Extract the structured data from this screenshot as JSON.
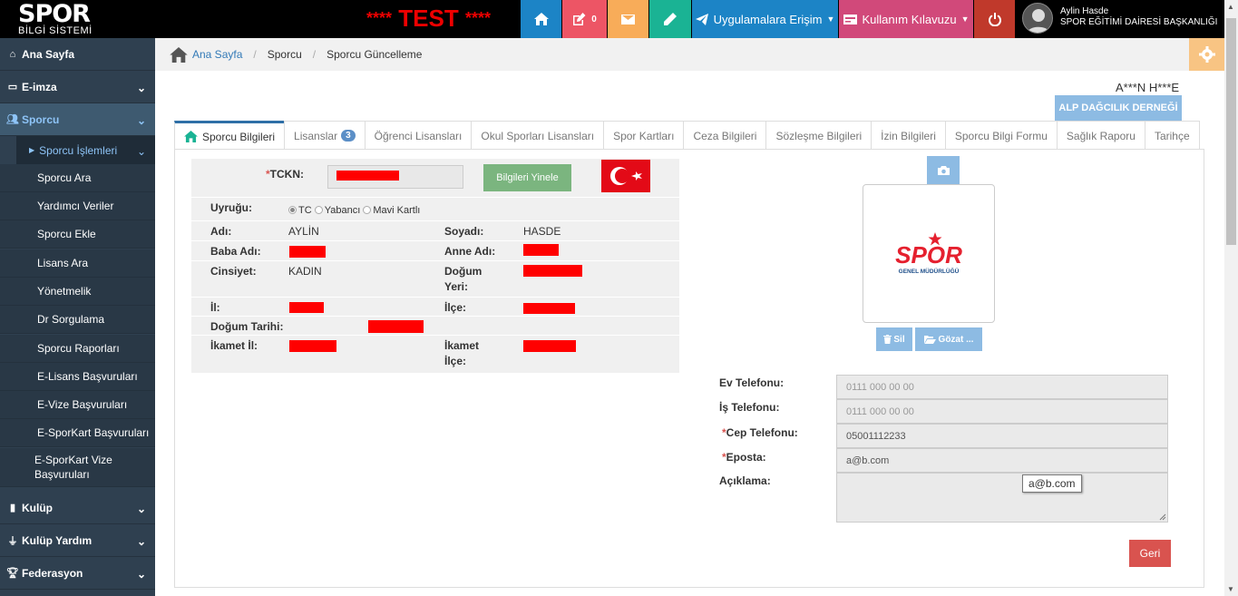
{
  "app": {
    "logo_line1": "SPOR",
    "logo_line2": "BİLGİ SİSTEMİ",
    "test_label": "TEST",
    "test_stars": "****"
  },
  "topbar": {
    "notifications_count": "0",
    "apps_access_label": "Uygulamalara Erişim",
    "user_guide_label": "Kullanım Kılavuzu",
    "user_name": "Aylin Hasde",
    "user_department": "SPOR EĞİTİMİ DAİRESİ BAŞKANLIĞI",
    "colors": {
      "home": "#1c84c6",
      "edit": "#ed5565",
      "mail": "#f8ac59",
      "pencil": "#1ab394",
      "apps": "#1c84c6",
      "guide": "#d1497a",
      "power": "#c0392b"
    }
  },
  "sidebar": {
    "items": [
      {
        "label": "Ana Sayfa",
        "icon": "home-icon"
      },
      {
        "label": "E-imza",
        "icon": "card-icon"
      },
      {
        "label": "Sporcu",
        "icon": "users-icon"
      },
      {
        "label": "Kulüp",
        "icon": "bar-chart-icon"
      },
      {
        "label": "Kulüp Yardım",
        "icon": "plug-icon"
      },
      {
        "label": "Federasyon",
        "icon": "trophy-icon"
      }
    ],
    "subheader": "Sporcu İşlemleri",
    "subitems": [
      "Sporcu Ara",
      "Yardımcı Veriler",
      "Sporcu Ekle",
      "Lisans Ara",
      "Yönetmelik",
      "Dr Sorgulama",
      "Sporcu Raporları",
      "E-Lisans Başvuruları",
      "E-Vize Başvuruları",
      "E-SporKart Başvuruları",
      "E-SporKart Vize Başvuruları"
    ]
  },
  "breadcrumb": [
    "Ana Sayfa",
    "Sporcu",
    "Sporcu Güncelleme"
  ],
  "athlete_masked_name": "A***N H***E",
  "club_button": "ALP DAĞCILIK DERNEĞİ",
  "tabs": [
    {
      "label": "Sporcu Bilgileri",
      "active": true
    },
    {
      "label": "Lisanslar",
      "badge": "3"
    },
    {
      "label": "Öğrenci Lisansları"
    },
    {
      "label": "Okul Sporları Lisansları"
    },
    {
      "label": "Spor Kartları"
    },
    {
      "label": "Ceza Bilgileri"
    },
    {
      "label": "Sözleşme Bilgileri"
    },
    {
      "label": "İzin Bilgileri"
    },
    {
      "label": "Sporcu Bilgi Formu"
    },
    {
      "label": "Sağlık Raporu"
    },
    {
      "label": "Tarihçe"
    }
  ],
  "form": {
    "required_mark": "*",
    "tckn_label": "TCKN:",
    "refresh_button": "Bilgileri Yinele",
    "nationality_label": "Uyruğu:",
    "nationality_options": [
      "TC",
      "Yabancı",
      "Mavi Kartlı"
    ],
    "nationality_selected": "TC",
    "ad_label": "Adı:",
    "ad_value": "AYLİN",
    "soyad_label": "Soyadı:",
    "soyad_value": "HASDE",
    "baba_label": "Baba Adı:",
    "anne_label": "Anne Adı:",
    "cinsiyet_label": "Cinsiyet:",
    "cinsiyet_value": "KADIN",
    "dogum_yeri_label_1": "Doğum",
    "dogum_yeri_label_2": "Yeri:",
    "il_label": "İl:",
    "ilce_label": "İlçe:",
    "dogum_tarihi_label": "Doğum Tarihi:",
    "ikamet_il_label": "İkamet İl:",
    "ikamet_ilce_label_1": "İkamet",
    "ikamet_ilce_label_2": "İlçe:"
  },
  "photo": {
    "logo_text": "SPOR",
    "logo_sub": "GENEL MÜDÜRLÜĞÜ",
    "delete_button": "Sil",
    "browse_button": "Gözat ..."
  },
  "contact": {
    "ev_label": "Ev Telefonu:",
    "ev_placeholder": "0111 000 00 00",
    "is_label": "İş Telefonu:",
    "is_placeholder": "0111 000 00 00",
    "cep_label": "Cep Telefonu:",
    "cep_value": "05001112233",
    "eposta_label": "Eposta:",
    "eposta_value": "a@b.com",
    "aciklama_label": "Açıklama:",
    "tooltip": "a@b.com"
  },
  "back_button": "Geri"
}
